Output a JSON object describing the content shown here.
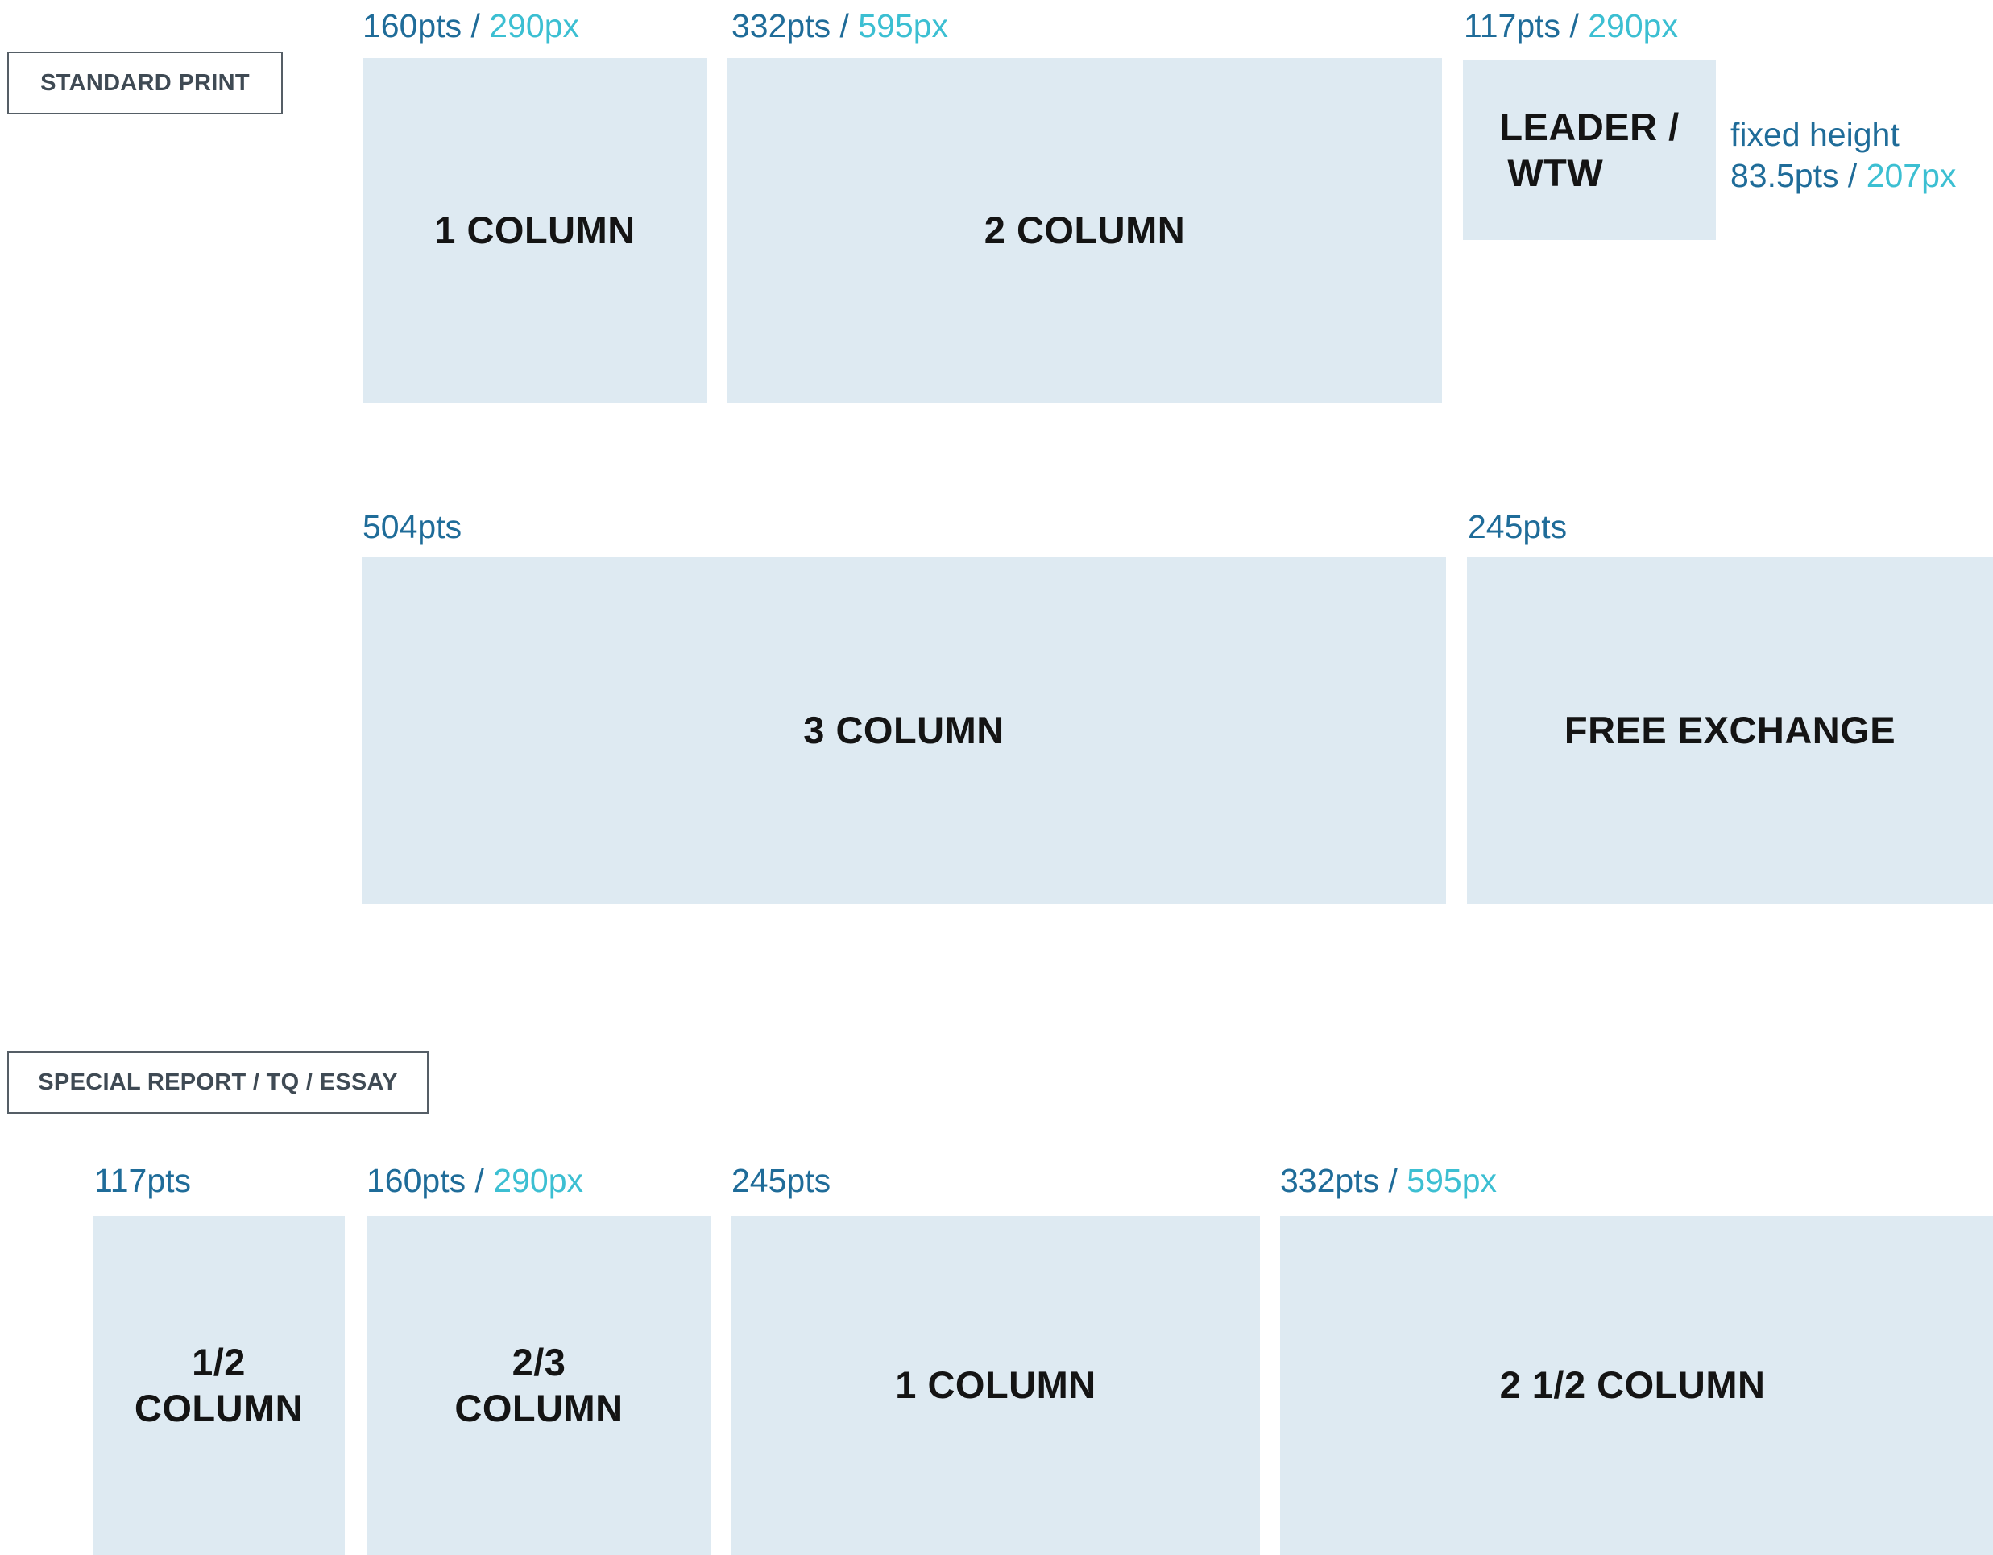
{
  "standard_print": {
    "tag": "STANDARD PRINT",
    "boxes": [
      {
        "label": "1 COLUMN",
        "pts": "160pts",
        "sep": " / ",
        "px": "290px"
      },
      {
        "label": "2 COLUMN",
        "pts": "332pts",
        "sep": " / ",
        "px": "595px"
      },
      {
        "label_line1": "LEADER /",
        "label_line2": "WTW",
        "pts": "117pts",
        "sep": " / ",
        "px": "290px"
      },
      {
        "label": "3 COLUMN",
        "pts": "504pts"
      },
      {
        "label": "FREE EXCHANGE",
        "pts": "245pts"
      }
    ],
    "fixed_height": {
      "line1": "fixed height",
      "pts": "83.5pts",
      "sep": " / ",
      "px": "207px"
    }
  },
  "special_report": {
    "tag": "SPECIAL REPORT / TQ / ESSAY",
    "boxes": [
      {
        "label_line1": "1/2",
        "label_line2": "COLUMN",
        "pts": "117pts"
      },
      {
        "label_line1": "2/3",
        "label_line2": "COLUMN",
        "pts": "160pts",
        "sep": " / ",
        "px": "290px"
      },
      {
        "label": "1 COLUMN",
        "pts": "245pts"
      },
      {
        "label": "2 1/2 COLUMN",
        "pts": "332pts",
        "sep": " / ",
        "px": "595px"
      }
    ]
  },
  "colors": {
    "box_fill": "#deeaf2",
    "pts_text": "#1f6c99",
    "px_text": "#3cbfd2",
    "label_text": "#141414",
    "tag_border": "#555e66"
  }
}
